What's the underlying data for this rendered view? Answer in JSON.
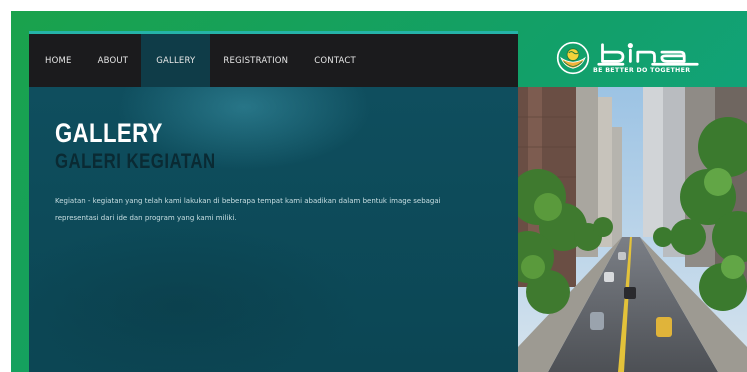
{
  "nav": {
    "items": [
      {
        "label": "HOME",
        "active": false
      },
      {
        "label": "ABOUT",
        "active": false
      },
      {
        "label": "GALLERY",
        "active": true
      },
      {
        "label": "REGISTRATION",
        "active": false
      },
      {
        "label": "CONTACT",
        "active": false
      }
    ]
  },
  "brand": {
    "name": "Bina",
    "tagline": "BE BETTER DO TOGETHER",
    "emblem_icon": "hands-globe-icon"
  },
  "hero": {
    "title": "GALLERY",
    "subtitle": "GALERI KEGIATAN",
    "description": "Kegiatan - kegiatan yang telah kami lakukan di beberapa tempat kami abadikan dalam bentuk image sebagai representasi dari ide dan program yang kami miliki."
  },
  "colors": {
    "frame_green": "#1aa24c",
    "nav_bg": "#1b1b1d",
    "nav_active": "#0f3c48",
    "hero_bg": "#0f4e5e",
    "accent_teal": "#25b3a8"
  }
}
